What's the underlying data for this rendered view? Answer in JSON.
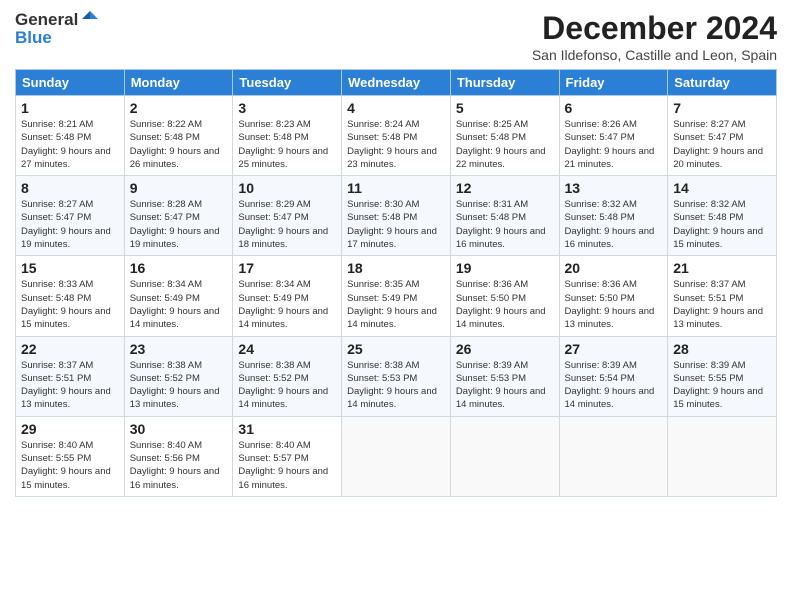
{
  "header": {
    "logo_line1": "General",
    "logo_line2": "Blue",
    "month_title": "December 2024",
    "subtitle": "San Ildefonso, Castille and Leon, Spain"
  },
  "weekdays": [
    "Sunday",
    "Monday",
    "Tuesday",
    "Wednesday",
    "Thursday",
    "Friday",
    "Saturday"
  ],
  "weeks": [
    [
      {
        "day": "1",
        "info": "Sunrise: 8:21 AM\nSunset: 5:48 PM\nDaylight: 9 hours and 27 minutes."
      },
      {
        "day": "2",
        "info": "Sunrise: 8:22 AM\nSunset: 5:48 PM\nDaylight: 9 hours and 26 minutes."
      },
      {
        "day": "3",
        "info": "Sunrise: 8:23 AM\nSunset: 5:48 PM\nDaylight: 9 hours and 25 minutes."
      },
      {
        "day": "4",
        "info": "Sunrise: 8:24 AM\nSunset: 5:48 PM\nDaylight: 9 hours and 23 minutes."
      },
      {
        "day": "5",
        "info": "Sunrise: 8:25 AM\nSunset: 5:48 PM\nDaylight: 9 hours and 22 minutes."
      },
      {
        "day": "6",
        "info": "Sunrise: 8:26 AM\nSunset: 5:47 PM\nDaylight: 9 hours and 21 minutes."
      },
      {
        "day": "7",
        "info": "Sunrise: 8:27 AM\nSunset: 5:47 PM\nDaylight: 9 hours and 20 minutes."
      }
    ],
    [
      {
        "day": "8",
        "info": "Sunrise: 8:27 AM\nSunset: 5:47 PM\nDaylight: 9 hours and 19 minutes."
      },
      {
        "day": "9",
        "info": "Sunrise: 8:28 AM\nSunset: 5:47 PM\nDaylight: 9 hours and 19 minutes."
      },
      {
        "day": "10",
        "info": "Sunrise: 8:29 AM\nSunset: 5:47 PM\nDaylight: 9 hours and 18 minutes."
      },
      {
        "day": "11",
        "info": "Sunrise: 8:30 AM\nSunset: 5:48 PM\nDaylight: 9 hours and 17 minutes."
      },
      {
        "day": "12",
        "info": "Sunrise: 8:31 AM\nSunset: 5:48 PM\nDaylight: 9 hours and 16 minutes."
      },
      {
        "day": "13",
        "info": "Sunrise: 8:32 AM\nSunset: 5:48 PM\nDaylight: 9 hours and 16 minutes."
      },
      {
        "day": "14",
        "info": "Sunrise: 8:32 AM\nSunset: 5:48 PM\nDaylight: 9 hours and 15 minutes."
      }
    ],
    [
      {
        "day": "15",
        "info": "Sunrise: 8:33 AM\nSunset: 5:48 PM\nDaylight: 9 hours and 15 minutes."
      },
      {
        "day": "16",
        "info": "Sunrise: 8:34 AM\nSunset: 5:49 PM\nDaylight: 9 hours and 14 minutes."
      },
      {
        "day": "17",
        "info": "Sunrise: 8:34 AM\nSunset: 5:49 PM\nDaylight: 9 hours and 14 minutes."
      },
      {
        "day": "18",
        "info": "Sunrise: 8:35 AM\nSunset: 5:49 PM\nDaylight: 9 hours and 14 minutes."
      },
      {
        "day": "19",
        "info": "Sunrise: 8:36 AM\nSunset: 5:50 PM\nDaylight: 9 hours and 14 minutes."
      },
      {
        "day": "20",
        "info": "Sunrise: 8:36 AM\nSunset: 5:50 PM\nDaylight: 9 hours and 13 minutes."
      },
      {
        "day": "21",
        "info": "Sunrise: 8:37 AM\nSunset: 5:51 PM\nDaylight: 9 hours and 13 minutes."
      }
    ],
    [
      {
        "day": "22",
        "info": "Sunrise: 8:37 AM\nSunset: 5:51 PM\nDaylight: 9 hours and 13 minutes."
      },
      {
        "day": "23",
        "info": "Sunrise: 8:38 AM\nSunset: 5:52 PM\nDaylight: 9 hours and 13 minutes."
      },
      {
        "day": "24",
        "info": "Sunrise: 8:38 AM\nSunset: 5:52 PM\nDaylight: 9 hours and 14 minutes."
      },
      {
        "day": "25",
        "info": "Sunrise: 8:38 AM\nSunset: 5:53 PM\nDaylight: 9 hours and 14 minutes."
      },
      {
        "day": "26",
        "info": "Sunrise: 8:39 AM\nSunset: 5:53 PM\nDaylight: 9 hours and 14 minutes."
      },
      {
        "day": "27",
        "info": "Sunrise: 8:39 AM\nSunset: 5:54 PM\nDaylight: 9 hours and 14 minutes."
      },
      {
        "day": "28",
        "info": "Sunrise: 8:39 AM\nSunset: 5:55 PM\nDaylight: 9 hours and 15 minutes."
      }
    ],
    [
      {
        "day": "29",
        "info": "Sunrise: 8:40 AM\nSunset: 5:55 PM\nDaylight: 9 hours and 15 minutes."
      },
      {
        "day": "30",
        "info": "Sunrise: 8:40 AM\nSunset: 5:56 PM\nDaylight: 9 hours and 16 minutes."
      },
      {
        "day": "31",
        "info": "Sunrise: 8:40 AM\nSunset: 5:57 PM\nDaylight: 9 hours and 16 minutes."
      },
      {
        "day": "",
        "info": ""
      },
      {
        "day": "",
        "info": ""
      },
      {
        "day": "",
        "info": ""
      },
      {
        "day": "",
        "info": ""
      }
    ]
  ]
}
